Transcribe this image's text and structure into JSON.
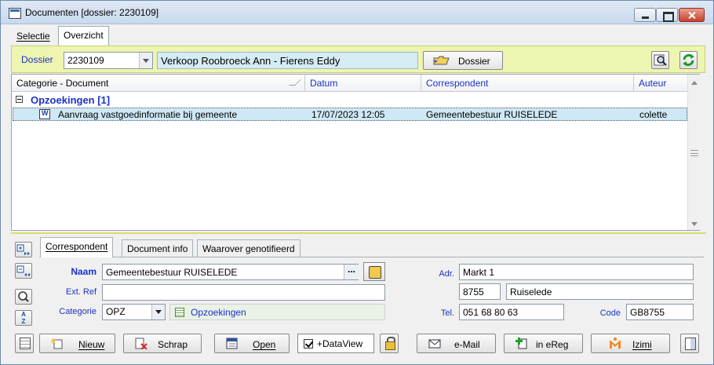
{
  "window": {
    "title": "Documenten  [dossier: 2230109]"
  },
  "top_tabs": [
    "Selectie",
    "Overzicht"
  ],
  "dossier": {
    "label": "Dossier",
    "number": "2230109",
    "name": "Verkoop Roobroeck Ann - Fierens Eddy",
    "button_label": "Dossier"
  },
  "grid": {
    "columns": [
      "Categorie - Document",
      "Datum",
      "Correspondent",
      "Auteur"
    ],
    "group": "Opzoekingen [1]",
    "rows": [
      {
        "document": "Aanvraag vastgoedinformatie bij gemeente",
        "datum": "17/07/2023 12:05",
        "correspondent": "Gemeentebestuur RUISELEDE",
        "auteur": "colette"
      }
    ]
  },
  "side_buttons": {
    "sort": "A\nZ"
  },
  "detail_tabs": [
    "Correspondent",
    "Document info",
    "Waarover genotifieerd"
  ],
  "correspondent": {
    "naam_label": "Naam",
    "naam": "Gemeentebestuur RUISELEDE",
    "naam_button": "...",
    "extref_label": "Ext. Ref",
    "extref": "",
    "categorie_label": "Categorie",
    "categorie_code": "OPZ",
    "categorie_desc": "Opzoekingen",
    "adr_label": "Adr.",
    "adres": "Markt 1",
    "postcode": "8755",
    "gemeente": "Ruiselede",
    "tel_label": "Tel.",
    "tel": "051 68 80 63",
    "code_label": "Code",
    "code": "GB8755"
  },
  "toolbar": {
    "nieuw": "Nieuw",
    "schrap": "Schrap",
    "open": "Open",
    "dataview": "+DataView",
    "dataview_checked": true,
    "email": "e-Mail",
    "ereg": "in eReg",
    "izimi": "Izimi"
  },
  "colors": {
    "accent_blue": "#1a32c8",
    "dossier_bar": "#eef5b0",
    "selected_row": "#cfe8f6"
  }
}
